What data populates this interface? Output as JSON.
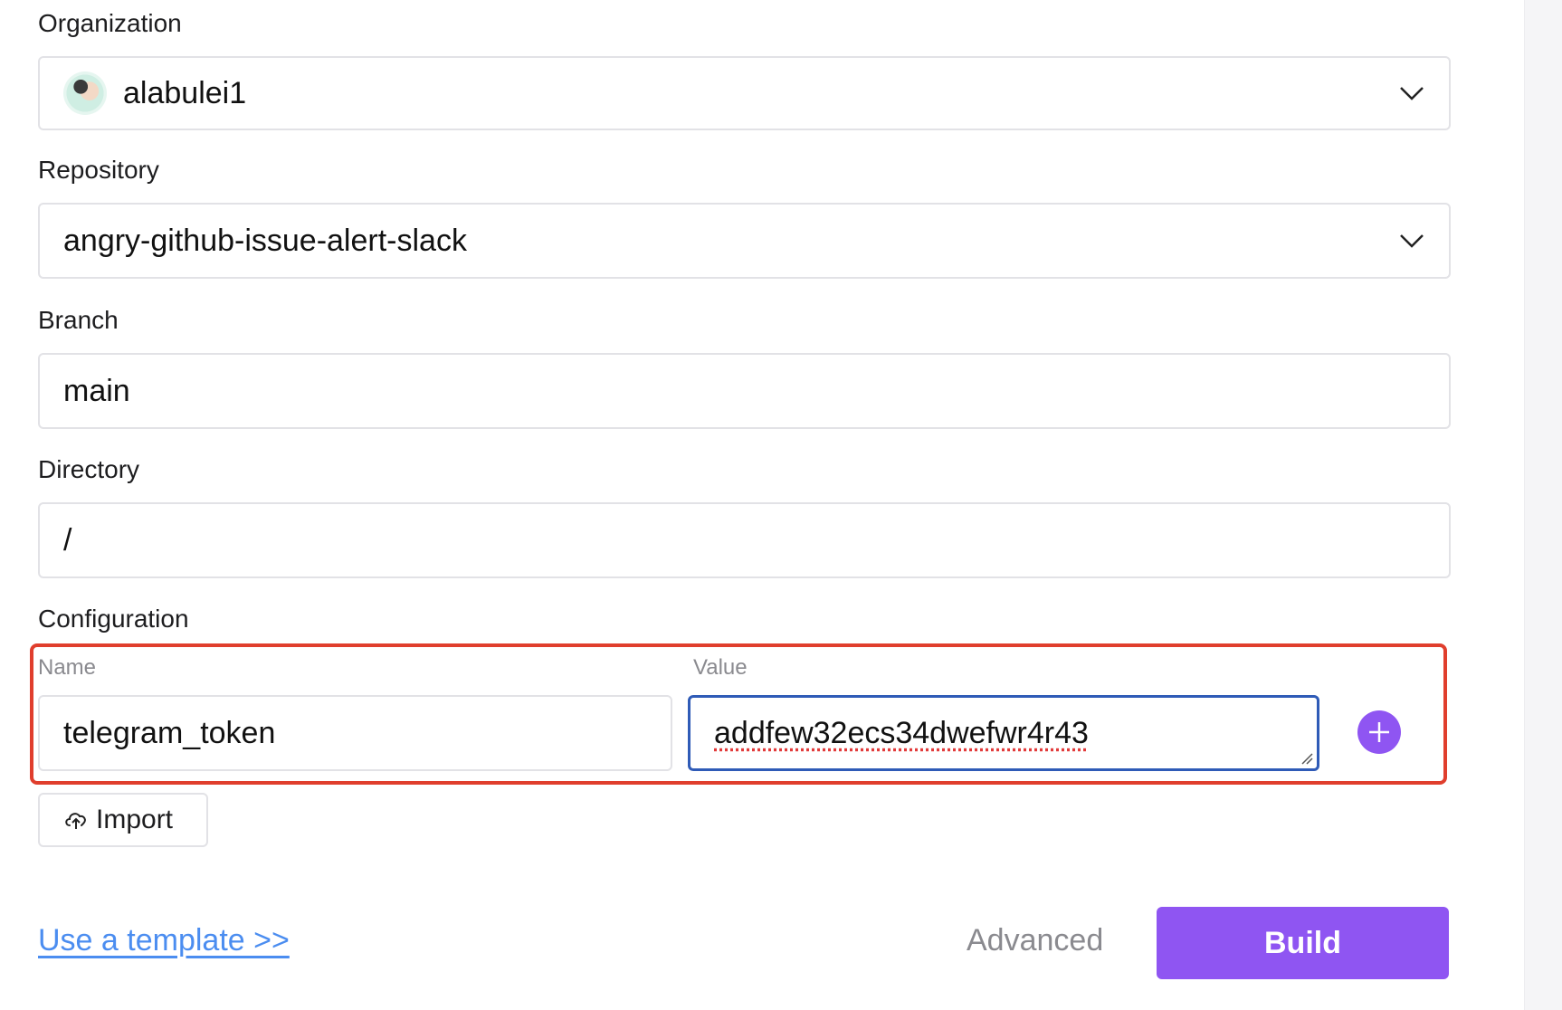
{
  "form": {
    "organization": {
      "label": "Organization",
      "value": "alabulei1"
    },
    "repository": {
      "label": "Repository",
      "value": "angry-github-issue-alert-slack"
    },
    "branch": {
      "label": "Branch",
      "value": "main"
    },
    "directory": {
      "label": "Directory",
      "value": "/"
    },
    "configuration": {
      "label": "Configuration",
      "name_header": "Name",
      "value_header": "Value",
      "rows": [
        {
          "name": "telegram_token",
          "value": "addfew32ecs34dwefwr4r43"
        }
      ]
    },
    "import_label": "Import",
    "template_link": "Use a template >>",
    "advanced_label": "Advanced",
    "build_label": "Build"
  },
  "icons": {
    "chevron": "chevron-down-icon",
    "upload": "cloud-upload-icon",
    "add": "plus-icon"
  },
  "colors": {
    "accent": "#8f55f2",
    "link": "#4b8df0",
    "highlight": "#e03e2d",
    "focus": "#2f5bb7"
  }
}
